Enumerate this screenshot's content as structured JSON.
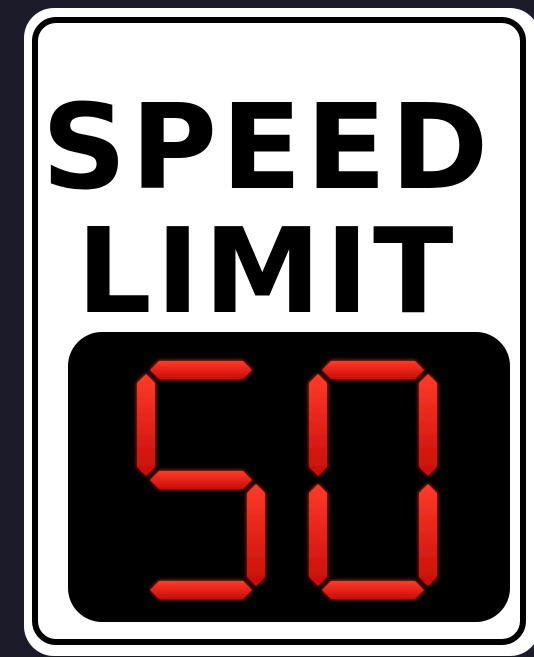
{
  "sign": {
    "line1": "SPEED",
    "line2": "LIMIT",
    "speed_value": "50"
  },
  "colors": {
    "background": "#1c1b2a",
    "sign_face": "#ffffff",
    "sign_border": "#000000",
    "display_panel": "#000000",
    "led_segment": "#e8140f"
  }
}
